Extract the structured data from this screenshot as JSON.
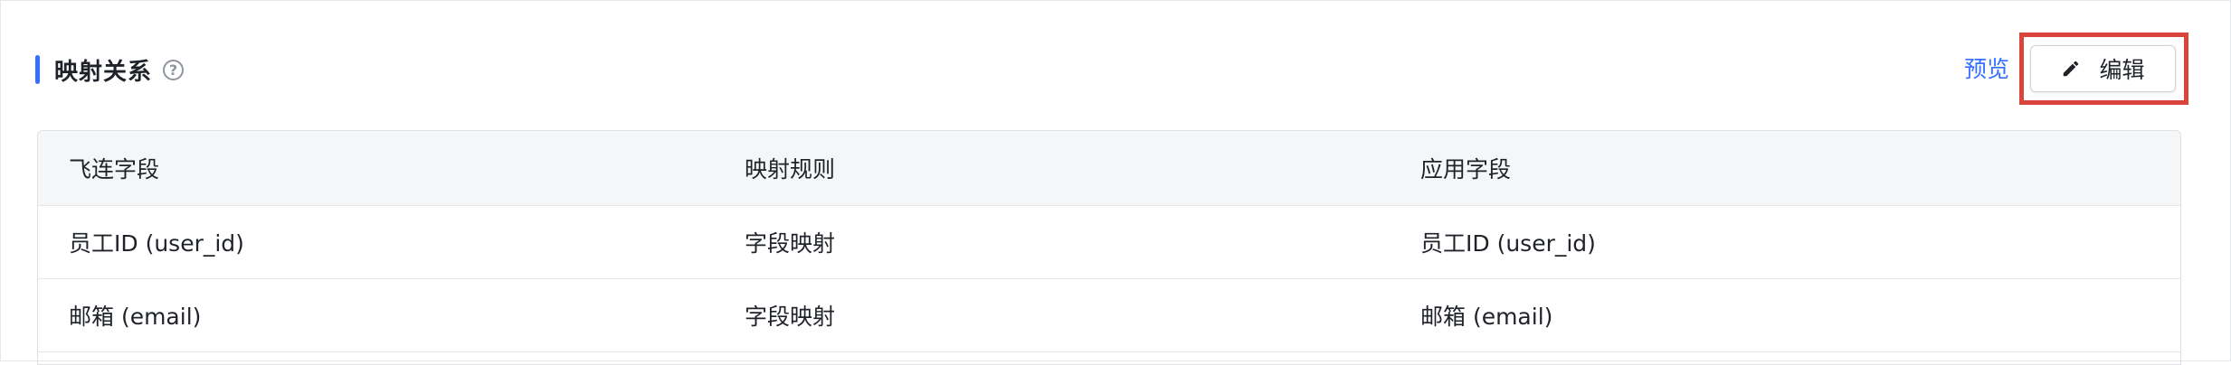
{
  "section": {
    "title": "映射关系",
    "help_icon": "question-circle-icon",
    "help_glyph": "?"
  },
  "actions": {
    "preview_label": "预览",
    "edit_label": "编辑",
    "edit_icon": "pencil-icon"
  },
  "colors": {
    "accent": "#3370ff",
    "highlight": "#d9453b",
    "header_bg": "#f5f6f7"
  },
  "table": {
    "headers": [
      "飞连字段",
      "映射规则",
      "应用字段"
    ],
    "rows": [
      [
        "员工ID (user_id)",
        "字段映射",
        "员工ID (user_id)"
      ],
      [
        "邮箱 (email)",
        "字段映射",
        "邮箱 (email)"
      ]
    ]
  }
}
